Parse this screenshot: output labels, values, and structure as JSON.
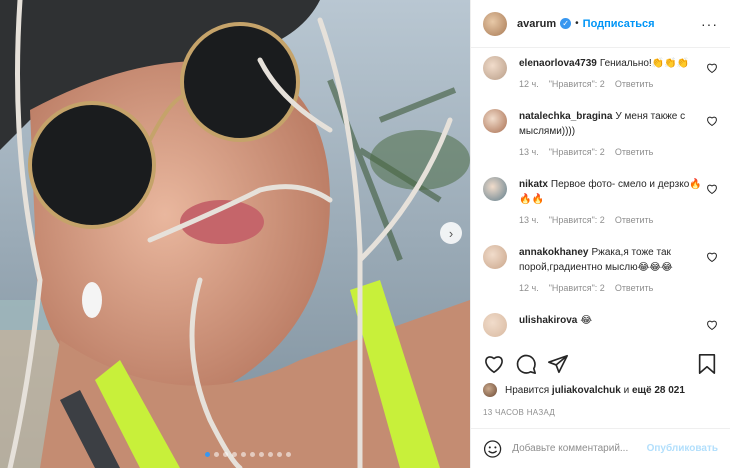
{
  "post": {
    "username": "avarum",
    "verified_mark": "✓",
    "separator": "•",
    "follow_label": "Подписаться",
    "more_icon": "more-icon",
    "carousel_dots": 10,
    "active_dot": 0
  },
  "comments": [
    {
      "user": "elenaorlova4739",
      "text": "Гениально!👏👏👏",
      "time": "12 ч.",
      "likes": "\"Нравится\": 2",
      "reply": "Ответить",
      "avatar_color": "#b79c86"
    },
    {
      "user": "natalechka_bragina",
      "text": "У меня также с мыслями))))",
      "time": "13 ч.",
      "likes": "\"Нравится\": 2",
      "reply": "Ответить",
      "avatar_color": "#a86d4f"
    },
    {
      "user": "nikatx",
      "text": "Первое фото- смело и дерзко🔥🔥🔥",
      "time": "13 ч.",
      "likes": "\"Нравится\": 2",
      "reply": "Ответить",
      "avatar_color": "#5f7d8c"
    },
    {
      "user": "annakokhaney",
      "text": "Ржака,я тоже так порой,градиентно мыслю😂😂😂",
      "time": "12 ч.",
      "likes": "\"Нравится\": 2",
      "reply": "Ответить",
      "avatar_color": "#c9a58a"
    },
    {
      "user": "ulishakirova",
      "text": "😂",
      "time": "",
      "likes": "",
      "reply": "",
      "avatar_color": "#d8b9a0"
    }
  ],
  "likes_line": {
    "prefix": "Нравится",
    "user": "juliakovalchuk",
    "middle": "и",
    "rest": "ещё 28 021"
  },
  "timestamp": "13 ЧАСОВ НАЗАД",
  "add_comment": {
    "placeholder": "Добавьте комментарий...",
    "publish_label": "Опубликовать"
  },
  "colors": {
    "accent": "#0095f6",
    "verified": "#3897f0",
    "publish_disabled": "#b2dffc",
    "muted": "#8e8e8e"
  }
}
